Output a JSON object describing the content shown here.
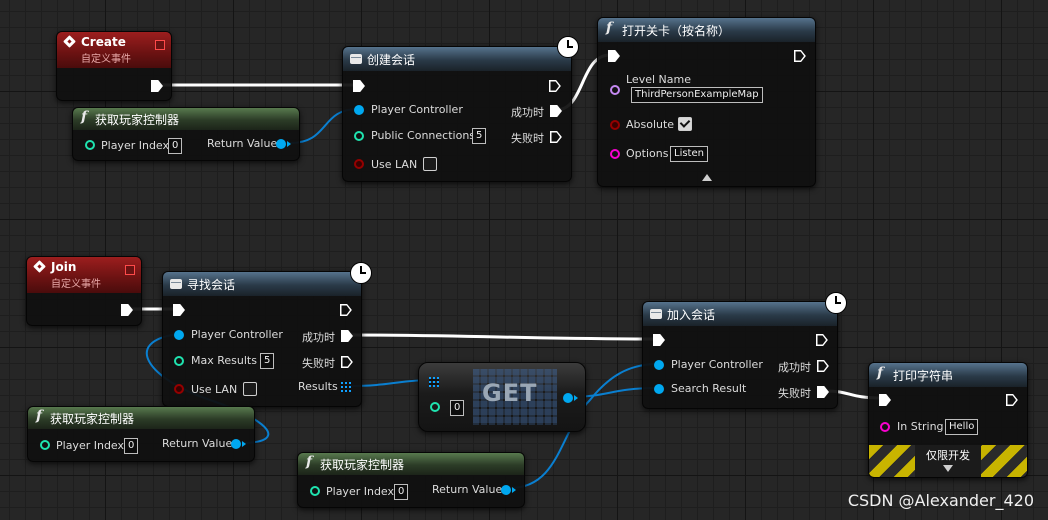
{
  "nodes": {
    "create_event": {
      "title": "Create",
      "subtitle": "自定义事件"
    },
    "join_event": {
      "title": "Join",
      "subtitle": "自定义事件"
    },
    "get_pc_1": {
      "title": "获取玩家控制器",
      "in_pin": "Player Index",
      "in_value": "0",
      "out_pin": "Return Value"
    },
    "get_pc_2": {
      "title": "获取玩家控制器",
      "in_pin": "Player Index",
      "in_value": "0",
      "out_pin": "Return Value"
    },
    "get_pc_3": {
      "title": "获取玩家控制器",
      "in_pin": "Player Index",
      "in_value": "0",
      "out_pin": "Return Value"
    },
    "create_session": {
      "title": "创建会话",
      "pins": {
        "player_controller": "Player Controller",
        "public_connections": "Public Connections",
        "public_connections_value": "5",
        "use_lan": "Use LAN",
        "success": "成功时",
        "failure": "失败时"
      }
    },
    "open_level": {
      "title": "打开关卡（按名称）",
      "pins": {
        "level_name": "Level Name",
        "level_name_value": "ThirdPersonExampleMap",
        "absolute": "Absolute",
        "options": "Options",
        "options_value": "Listen"
      }
    },
    "find_sessions": {
      "title": "寻找会话",
      "pins": {
        "player_controller": "Player Controller",
        "max_results": "Max Results",
        "max_results_value": "5",
        "use_lan": "Use LAN",
        "success": "成功时",
        "failure": "失败时",
        "results": "Results"
      }
    },
    "get_node": {
      "title": "GET",
      "index_value": "0"
    },
    "join_session": {
      "title": "加入会话",
      "pins": {
        "player_controller": "Player Controller",
        "search_result": "Search Result",
        "success": "成功时",
        "failure": "失败时"
      }
    },
    "print_string": {
      "title": "打印字符串",
      "pins": {
        "in_string": "In String",
        "in_string_value": "Hello"
      },
      "dev_only_label": "仅限开发"
    }
  },
  "watermark": "CSDN @Alexander_420",
  "colors": {
    "exec": "#ffffff",
    "object_pin": "#00a8f0",
    "int_pin": "#1fe3af",
    "bool_pin": "#950000",
    "string_pin": "#f800ce",
    "name_pin": "#c589f2"
  }
}
